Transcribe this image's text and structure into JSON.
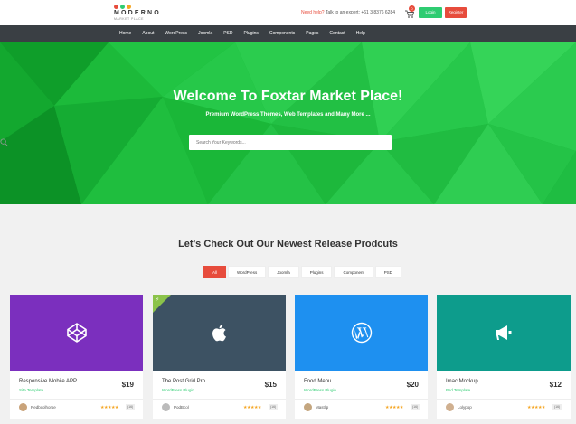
{
  "header": {
    "logo_name": "MODERNO",
    "logo_sub": "MARKET PLACE",
    "help_red": "Need help?",
    "help_text": " Talk to an expert: +61 3 8376 6284",
    "cart_count": "0",
    "login_label": "Login",
    "register_label": "Register"
  },
  "nav": [
    "Home",
    "About",
    "WordPress",
    "Joomla",
    "PSD",
    "Plugins",
    "Components",
    "Pages",
    "Contact",
    "Help"
  ],
  "hero": {
    "title": "Welcome To Foxtar Market Place!",
    "subtitle": "Premium WordPress Themes, Web Templates and Many More ...",
    "search_placeholder": "Search Your Keywords..."
  },
  "section_title": "Let's Check Out Our Newest Release Prodcuts",
  "filters": [
    "All",
    "WordPress",
    "Joomla",
    "Plugins",
    "Component",
    "PSD"
  ],
  "active_filter": "All",
  "products": [
    {
      "title": "Responsive Mobile APP",
      "category": "Site Template",
      "price": "$19",
      "author": "Redbcolhorse",
      "stars": "★★★★★",
      "rating_count": "(16)",
      "color": "#7b2fbe",
      "icon": "codepen-icon"
    },
    {
      "title": "The Post Grid Pro",
      "category": "WordPress Plugin",
      "price": "$15",
      "author": "PodBcol",
      "stars": "★★★★★",
      "rating_count": "(16)",
      "color": "#3d5263",
      "icon": "apple-icon"
    },
    {
      "title": "Food Menu",
      "category": "WordPress Plugin",
      "price": "$20",
      "author": "Mastlip",
      "stars": "★★★★★",
      "rating_count": "(16)",
      "color": "#1e90f0",
      "icon": "wordpress-icon"
    },
    {
      "title": "Imac Mockup",
      "category": "Psd Template",
      "price": "$12",
      "author": "Lolypop",
      "stars": "★★★★★",
      "rating_count": "(16)",
      "color": "#0d9c8c",
      "icon": "megaphone-icon"
    }
  ],
  "colors": {
    "accent_red": "#e74c3c",
    "accent_green": "#2ecc71",
    "nav_bg": "#3a3f44",
    "hero_green": "#17b134"
  }
}
